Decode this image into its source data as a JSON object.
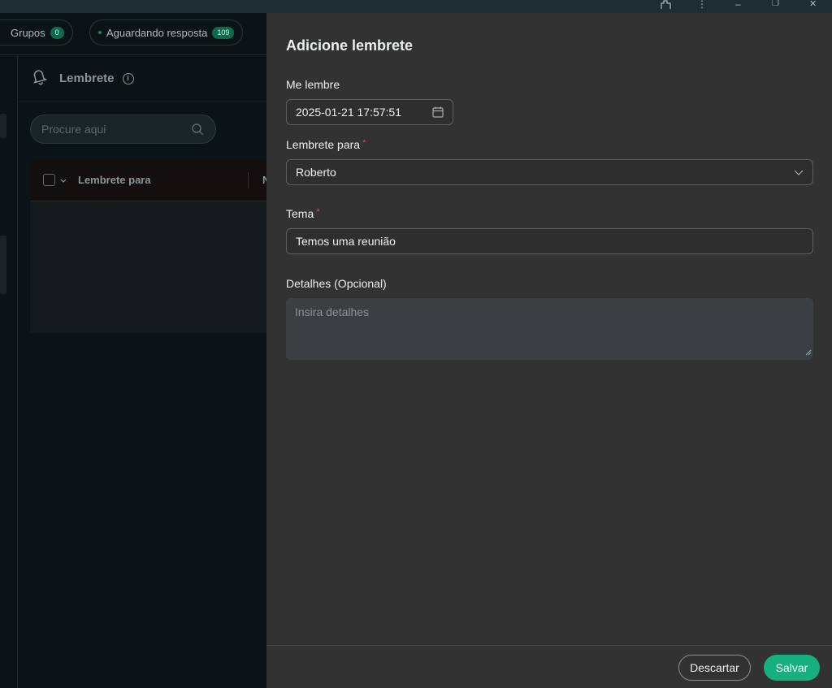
{
  "titlebar": {
    "more_icon": "⋮",
    "minimize_icon": "–",
    "restore_icon": "❐",
    "close_icon": "✕"
  },
  "background": {
    "chips": [
      {
        "label": "Grupos",
        "count": "0"
      },
      {
        "label": "Aguardando resposta",
        "count": "109"
      }
    ],
    "panel_title": "Lembrete",
    "info_icon": "i",
    "search_placeholder": "Procure aqui",
    "table_header": {
      "col1": "Lembrete para",
      "col2_partial": "N"
    }
  },
  "drawer": {
    "title": "Adicione lembrete",
    "remind_me_label": "Me lembre",
    "remind_me_value": "2025-01-21 17:57:51",
    "reminder_for_label": "Lembrete para",
    "reminder_for_value": "Roberto",
    "required_mark": "*",
    "topic_label": "Tema",
    "topic_value": "Temos uma reunião",
    "details_label": "Detalhes (Opcional)",
    "details_placeholder": "Insira detalhes",
    "discard_label": "Descartar",
    "save_label": "Salvar"
  },
  "colors": {
    "accent": "#15b07d",
    "drawer_bg": "#323232",
    "required": "#e0444d"
  }
}
